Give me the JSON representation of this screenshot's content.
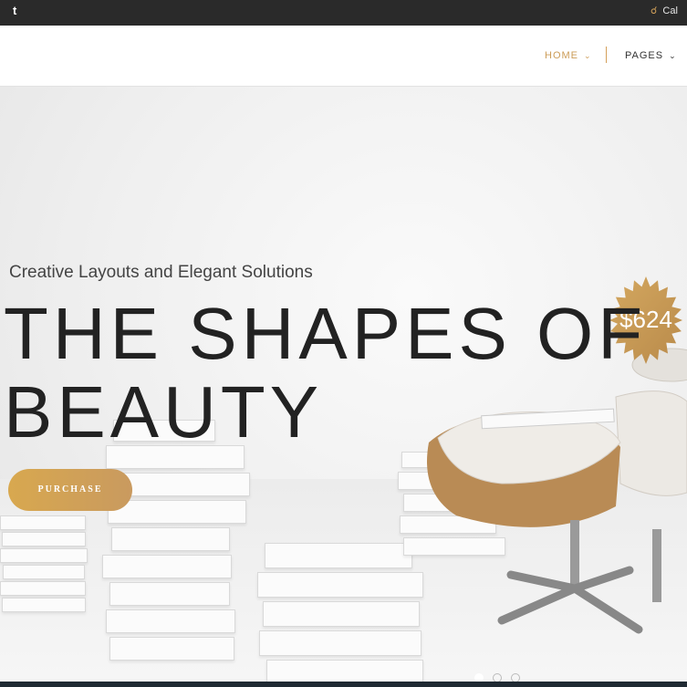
{
  "topbar": {
    "social_icon": "tumblr-icon",
    "call_icon": "headset-icon",
    "call_text": "Cal"
  },
  "nav": {
    "home": "HOME",
    "pages": "PAGES",
    "accent": "#cc9c57"
  },
  "hero": {
    "price": "$624",
    "subtitle": "Creative Layouts and Elegant Solutions",
    "headline_line1": "THE SHAPES OF",
    "headline_line2": "BEAUTY",
    "button": "PURCHASE",
    "slides": 3,
    "active_slide": 1
  }
}
